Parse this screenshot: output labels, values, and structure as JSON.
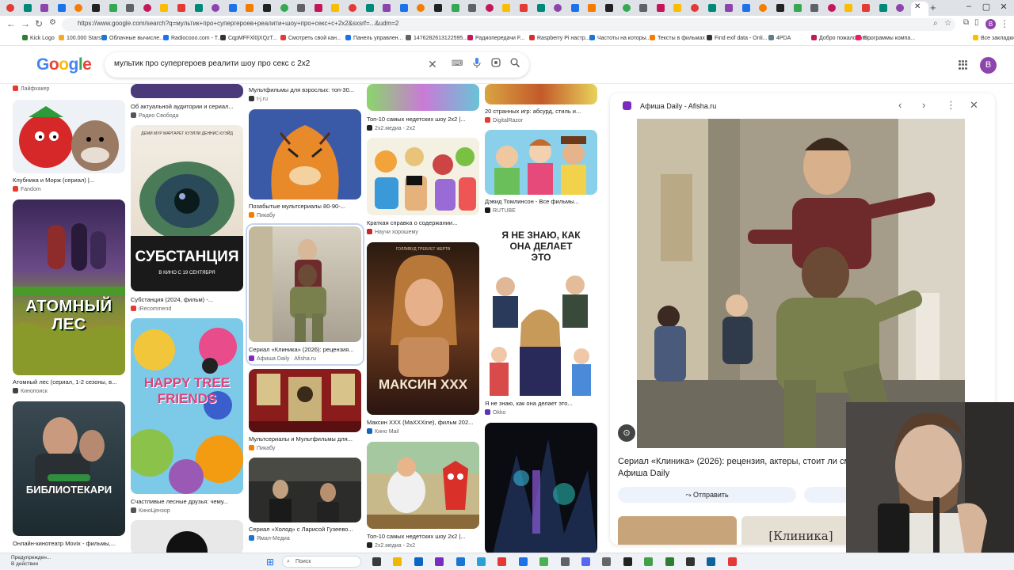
{
  "browser": {
    "url": "https://www.google.com/search?q=мультик+про+супергероев+реалити+шоу+про+секс+с+2x2&sxsrf=...&udm=2",
    "bookmarks": [
      "Kick Logo",
      "100.000 Stars",
      "Облачные вычисле...",
      "Radiocooo.com - T...",
      "CqpMFFXl0jXQzT...",
      "Смотреть свой кан...",
      "Панель управлен...",
      "1476282613122595...",
      "Радиопередачи F...",
      "Raspberry Pi настр...",
      "Частоты на которы...",
      "Тексты в фильмах",
      "Find exif data - Onli...",
      "4PDA",
      "Добро пожаловать...",
      "Программы компа...",
      "Все закладки"
    ]
  },
  "header": {
    "logo": "Google",
    "query": "мультик про супергероев реалити шоу про секс с 2x2",
    "profile_initial": "B"
  },
  "results": [
    {
      "caption": "Клубника и Морж (сериал) |...",
      "source": "Fandom",
      "color": "#e53935"
    },
    {
      "caption": "Атомный лес (сериал, 1-2 сезоны, в...",
      "source": "Кинопоиск",
      "color": "#444"
    },
    {
      "caption": "Онлайн-кинотеатр Movix - фильмы,...",
      "source": "",
      "color": "#444"
    },
    {
      "caption": "Об актуальной аудитории и сериал...",
      "source": "Радио Свобода",
      "color": "#555"
    },
    {
      "caption": "Субстанция (2024, фильм) -...",
      "source": "iRecommend",
      "color": "#e53935"
    },
    {
      "caption": "Счастливые лесные друзья: чему...",
      "source": "КиноЦензор",
      "color": "#555"
    },
    {
      "caption": "Мультфильмы для взрослых: топ-30...",
      "source": "t-j.ru",
      "color": "#333"
    },
    {
      "caption": "Позабытые мультсериалы 80-90-...",
      "source": "Пикабу",
      "color": "#f57c00"
    },
    {
      "caption": "Сериал «Клиника» (2026): рецензия...",
      "source": "Афиша Daily · Afisha.ru",
      "color": "#7b2cbf"
    },
    {
      "caption": "Мультсериалы и Мультфильмы для...",
      "source": "Пикабу",
      "color": "#f57c00"
    },
    {
      "caption": "Сериал «Холод» с Ларисой Гузеево...",
      "source": "Ямал-Медиа",
      "color": "#1976d2"
    },
    {
      "caption": "Топ-10 самых недетских шоу 2x2 |...",
      "source": "2x2.медиа - 2x2",
      "color": "#222"
    },
    {
      "caption": "Краткая справка о содержании...",
      "source": "Научи хорошему",
      "color": "#c62828"
    },
    {
      "caption": "Максин XXX (MaXXXine), фильм 202...",
      "source": "Кино Mail",
      "color": "#1565c0"
    },
    {
      "caption": "Топ-10 самых недетских шоу 2x2 |...",
      "source": "2x2.медиа - 2x2",
      "color": "#222"
    },
    {
      "caption": "20 странных игр: абсурд, стиль и...",
      "source": "DigitalRazor",
      "color": "#e53935"
    },
    {
      "caption": "Дэвид Томлинсон - Все фильмы...",
      "source": "RUTUBE",
      "color": "#1a1a1a"
    },
    {
      "caption": "Я не знаю, как она делает это...",
      "source": "Okko",
      "color": "#5e35b1"
    }
  ],
  "thumb_texts": {
    "substance": "СУБСТАНЦИЯ",
    "substance_sub": "В КИНО С 19 СЕНТЯБРЯ",
    "substance_top": "ДЕМИ МУР   МАРГАРЕТ КУЭЛЛИ   ДЕННИС КУЭЙД",
    "atomic": "АТОМНЫЙ ЛЕС",
    "htf": "HAPPY TREE FRIENDS",
    "maxxxine": "МАКСИН XXX",
    "maxxxine_top": "ГОЛЛИВУД ТРЕБУЕТ ЖЕРТВ",
    "librarians": "БИБЛИОТЕКАРИ",
    "kak": "Я НЕ ЗНАЮ, КАК ОНА ДЕЛАЕТ ЭТО"
  },
  "panel": {
    "source": "Афиша Daily - Afisha.ru",
    "title": "Сериал «Клиника» (2026): рецензия, актеры, стоит ли смотреть? - Афиша Daily",
    "share_label": "Отправить",
    "related_text": "[Клиника]"
  },
  "taskbar": {
    "weather_line1": "Предупрежден...",
    "weather_line2": "В действии",
    "search_placeholder": "Поиск"
  }
}
